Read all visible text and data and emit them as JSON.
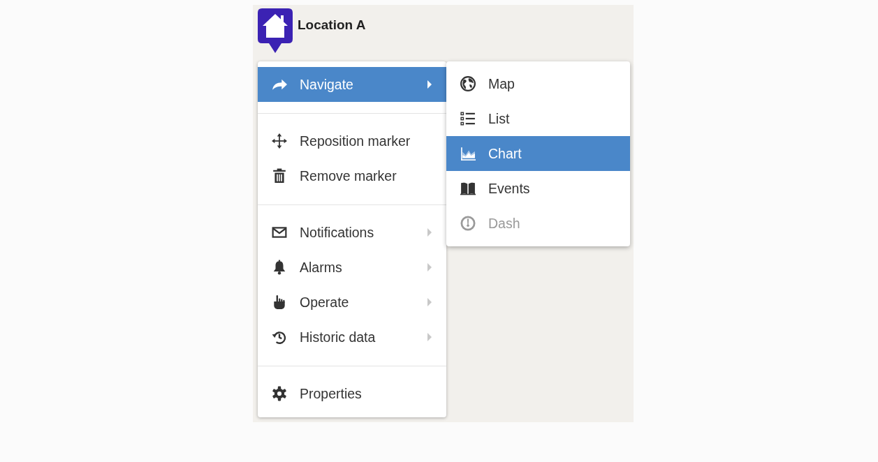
{
  "marker": {
    "title": "Location A"
  },
  "menu": {
    "sections": [
      [
        {
          "label": "Navigate",
          "selected": true,
          "submenu": true
        }
      ],
      [
        {
          "label": "Reposition marker",
          "selected": false,
          "submenu": false
        },
        {
          "label": "Remove marker",
          "selected": false,
          "submenu": false
        }
      ],
      [
        {
          "label": "Notifications",
          "selected": false,
          "submenu": true
        },
        {
          "label": "Alarms",
          "selected": false,
          "submenu": true
        },
        {
          "label": "Operate",
          "selected": false,
          "submenu": true
        },
        {
          "label": "Historic data",
          "selected": false,
          "submenu": true
        }
      ],
      [
        {
          "label": "Properties",
          "selected": false,
          "submenu": false
        }
      ]
    ]
  },
  "submenu": {
    "items": [
      {
        "label": "Map",
        "selected": false,
        "disabled": false
      },
      {
        "label": "List",
        "selected": false,
        "disabled": false
      },
      {
        "label": "Chart",
        "selected": true,
        "disabled": false
      },
      {
        "label": "Events",
        "selected": false,
        "disabled": false
      },
      {
        "label": "Dash",
        "selected": false,
        "disabled": true
      }
    ]
  }
}
